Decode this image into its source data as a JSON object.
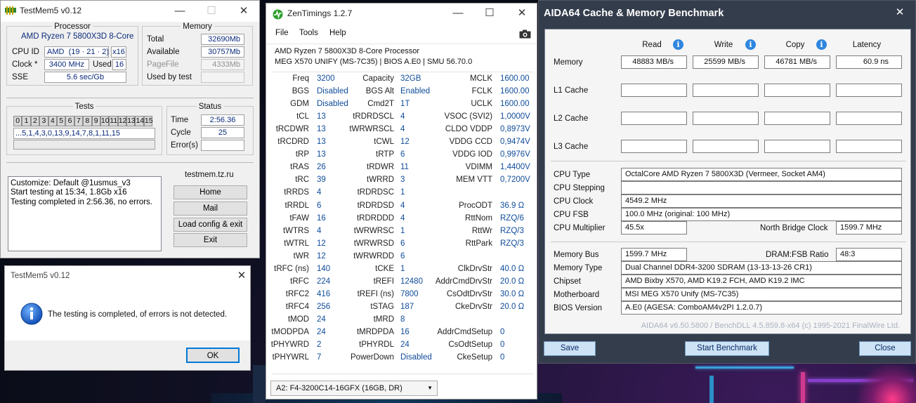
{
  "testmem": {
    "title": "TestMem5 v0.12",
    "processor": {
      "header": "Processor",
      "name": "AMD Ryzen 7 5800X3D 8-Core",
      "cpuid_label": "CPU ID",
      "cpuid_vendor": "AMD",
      "cpuid_value": "(19 · 21 · 2)",
      "threads": "x16",
      "clock_label": "Clock *",
      "clock_value": "3400 MHz",
      "used_label": "Used",
      "used_value": "16",
      "sse_label": "SSE",
      "sse_value": "5.6 sec/Gb"
    },
    "memory": {
      "header": "Memory",
      "total_label": "Total",
      "total_value": "32690Mb",
      "available_label": "Available",
      "available_value": "30757Mb",
      "pagefile_label": "PageFile",
      "pagefile_value": "4333Mb",
      "usedby_label": "Used by test",
      "usedby_value": ""
    },
    "tests": {
      "header": "Tests",
      "numbers": [
        "0",
        "1",
        "2",
        "3",
        "4",
        "5",
        "6",
        "7",
        "8",
        "9",
        "10",
        "11",
        "12",
        "13",
        "14",
        "15"
      ],
      "sequence": "...5,1,4,3,0,13,9,14,7,8,1,11,15"
    },
    "status": {
      "header": "Status",
      "time_label": "Time",
      "time_value": "2:56.36",
      "cycle_label": "Cycle",
      "cycle_value": "25",
      "errors_label": "Error(s)",
      "errors_value": ""
    },
    "log": [
      "Customize: Default @1usmus_v3",
      "Start testing at 15:34, 1.8Gb x16",
      "Testing completed in 2:56.36, no errors."
    ],
    "site": "testmem.tz.ru",
    "buttons": {
      "home": "Home",
      "mail": "Mail",
      "load": "Load config & exit",
      "exit": "Exit"
    }
  },
  "dialog": {
    "title": "TestMem5 v0.12",
    "message": "The testing is completed, of errors is not detected.",
    "ok": "OK"
  },
  "zentimings": {
    "title": "ZenTimings 1.2.7",
    "menu": [
      "File",
      "Tools",
      "Help"
    ],
    "cpu": "AMD Ryzen 7 5800X3D 8-Core Processor",
    "board": "MEG X570 UNIFY (MS-7C35) | BIOS A.E0 | SMU 56.70.0",
    "rows": [
      [
        "Freq",
        "3200",
        "Capacity",
        "32GB",
        "MCLK",
        "1600.00"
      ],
      [
        "BGS",
        "Disabled",
        "BGS Alt",
        "Enabled",
        "FCLK",
        "1600.00"
      ],
      [
        "GDM",
        "Disabled",
        "Cmd2T",
        "1T",
        "UCLK",
        "1600.00"
      ],
      [
        "tCL",
        "13",
        "tRDRDSCL",
        "4",
        "VSOC (SVI2)",
        "1,0000V"
      ],
      [
        "tRCDWR",
        "13",
        "tWRWRSCL",
        "4",
        "CLDO VDDP",
        "0,8973V"
      ],
      [
        "tRCDRD",
        "13",
        "tCWL",
        "12",
        "VDDG CCD",
        "0,9474V"
      ],
      [
        "tRP",
        "13",
        "tRTP",
        "6",
        "VDDG IOD",
        "0,9976V"
      ],
      [
        "tRAS",
        "26",
        "tRDWR",
        "11",
        "VDIMM",
        "1,4400V"
      ],
      [
        "tRC",
        "39",
        "tWRRD",
        "3",
        "MEM VTT",
        "0,7200V"
      ],
      [
        "tRRDS",
        "4",
        "tRDRDSC",
        "1",
        "",
        ""
      ],
      [
        "tRRDL",
        "6",
        "tRDRDSD",
        "4",
        "ProcODT",
        "36.9 Ω"
      ],
      [
        "tFAW",
        "16",
        "tRDRDDD",
        "4",
        "RttNom",
        "RZQ/6"
      ],
      [
        "tWTRS",
        "4",
        "tWRWRSC",
        "1",
        "RttWr",
        "RZQ/3"
      ],
      [
        "tWTRL",
        "12",
        "tWRWRSD",
        "6",
        "RttPark",
        "RZQ/3"
      ],
      [
        "tWR",
        "12",
        "tWRWRDD",
        "6",
        "",
        ""
      ],
      [
        "tRFC (ns)",
        "140",
        "tCKE",
        "1",
        "ClkDrvStr",
        "40.0 Ω"
      ],
      [
        "tRFC",
        "224",
        "tREFI",
        "12480",
        "AddrCmdDrvStr",
        "20.0 Ω"
      ],
      [
        "tRFC2",
        "416",
        "tREFI (ns)",
        "7800",
        "CsOdtDrvStr",
        "30.0 Ω"
      ],
      [
        "tRFC4",
        "256",
        "tSTAG",
        "187",
        "CkeDrvStr",
        "20.0 Ω"
      ],
      [
        "tMOD",
        "24",
        "tMRD",
        "8",
        "",
        ""
      ],
      [
        "tMODPDA",
        "24",
        "tMRDPDA",
        "16",
        "AddrCmdSetup",
        "0"
      ],
      [
        "tPHYWRD",
        "2",
        "tPHYRDL",
        "24",
        "CsOdtSetup",
        "0"
      ],
      [
        "tPHYWRL",
        "7",
        "PowerDown",
        "Disabled",
        "CkeSetup",
        "0"
      ]
    ],
    "dimm": "A2: F4-3200C14-16GFX (16GB, DR)"
  },
  "aida": {
    "title": "AIDA64 Cache & Memory Benchmark",
    "cols": [
      "Read",
      "Write",
      "Copy",
      "Latency"
    ],
    "memory": {
      "label": "Memory",
      "read": "48883 MB/s",
      "write": "25599 MB/s",
      "copy": "46781 MB/s",
      "latency": "60.9 ns"
    },
    "cache_labels": [
      "L1 Cache",
      "L2 Cache",
      "L3 Cache"
    ],
    "info": {
      "cpu_type_label": "CPU Type",
      "cpu_type": "OctalCore AMD Ryzen 7 5800X3D  (Vermeer, Socket AM4)",
      "cpu_stepping_label": "CPU Stepping",
      "cpu_stepping": "",
      "cpu_clock_label": "CPU Clock",
      "cpu_clock": "4549.2 MHz",
      "cpu_fsb_label": "CPU FSB",
      "cpu_fsb": "100.0 MHz  (original: 100 MHz)",
      "cpu_mult_label": "CPU Multiplier",
      "cpu_mult": "45.5x",
      "nb_clock_label": "North Bridge Clock",
      "nb_clock": "1599.7 MHz",
      "mem_bus_label": "Memory Bus",
      "mem_bus": "1599.7 MHz",
      "dram_ratio_label": "DRAM:FSB Ratio",
      "dram_ratio": "48:3",
      "mem_type_label": "Memory Type",
      "mem_type": "Dual Channel DDR4-3200 SDRAM  (13-13-13-26 CR1)",
      "chipset_label": "Chipset",
      "chipset": "AMD Bixby X570, AMD K19.2 FCH, AMD K19.2 IMC",
      "mobo_label": "Motherboard",
      "mobo": "MSI MEG X570 Unify (MS-7C35)",
      "bios_label": "BIOS Version",
      "bios": "A.E0  (AGESA: ComboAM4v2PI 1.2.0.7)"
    },
    "version": "AIDA64 v6.50.5800 / BenchDLL 4.5.859.8-x64  (c) 1995-2021 FinalWire Ltd.",
    "buttons": {
      "save": "Save",
      "start": "Start Benchmark",
      "close": "Close"
    }
  }
}
